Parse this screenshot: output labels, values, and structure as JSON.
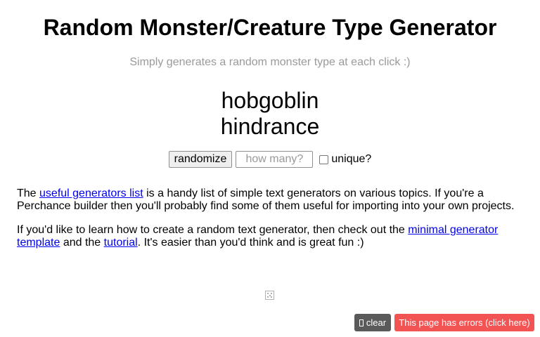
{
  "header": {
    "title": "Random Monster/Creature Type Generator",
    "subtitle": "Simply generates a random monster type at each click :)"
  },
  "output": {
    "lines": [
      "hobgoblin",
      "hindrance"
    ]
  },
  "controls": {
    "randomize_label": "randomize",
    "count_placeholder": "how many?",
    "count_value": "",
    "unique_label": "unique?",
    "unique_checked": false
  },
  "info": {
    "p1_prefix": "The ",
    "p1_link": "useful generators list",
    "p1_suffix": " is a handy list of simple text generators on various topics. If you're a Perchance builder then you'll probably find some of them useful for importing into your own projects.",
    "p2_prefix": "If you'd like to learn how to create a random text generator, then check out the ",
    "p2_link1": "minimal generator template",
    "p2_middle": " and the ",
    "p2_link2": "tutorial",
    "p2_suffix": ". It's easier than you'd think and is great fun :)"
  },
  "footer": {
    "dice_icon": "dice-icon",
    "clear_label": "clear",
    "errors_label": "This page has errors (click here)"
  },
  "colors": {
    "link": "#0000ee",
    "subtitle": "#9a9a9a",
    "clear_bg": "#5a5a5a",
    "errors_bg": "#f25454"
  }
}
